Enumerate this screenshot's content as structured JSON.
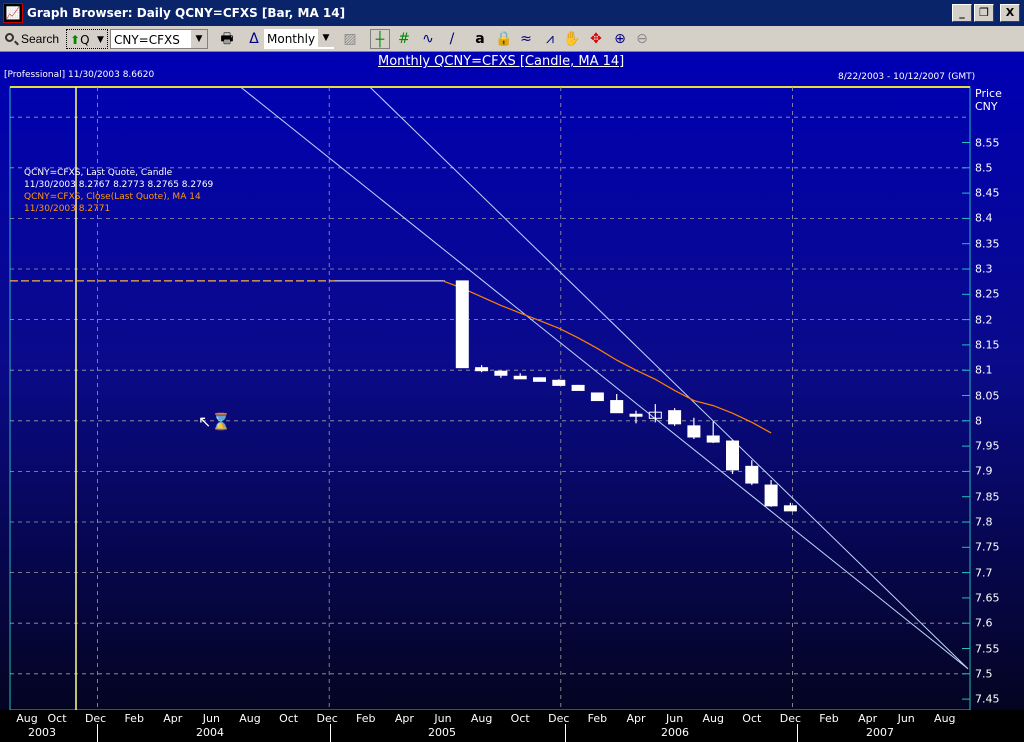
{
  "window": {
    "title": "Graph Browser: Daily QCNY=CFXS [Bar, MA 14]",
    "app_icon": "chart-icon",
    "minimize": "_",
    "maximize": "❐",
    "close": "X"
  },
  "toolbar": {
    "search_label": "Search",
    "quote_type": "Q",
    "symbol": "CNY=CFXS",
    "period": "Monthly",
    "icons": [
      "print-icon",
      "delta-icon",
      "folder-icon",
      "crosshair-icon",
      "grid-icon",
      "line-study-icon",
      "draw-line-icon",
      "text-icon",
      "lock-icon",
      "percent-scale-icon",
      "compare-icon",
      "pan-hand-icon",
      "move-icon",
      "zoom-in-icon",
      "zoom-out-icon"
    ]
  },
  "chart_data": {
    "type": "candlestick",
    "title": "Monthly QCNY=CFXS [Candle, MA 14]",
    "header_left": "[Professional] 11/30/2003 8.6620",
    "date_range": "8/22/2003 - 10/12/2007 (GMT)",
    "ylabel": "Price CNY",
    "ylabel_line1": "Price",
    "ylabel_line2": "CNY",
    "ylim": [
      7.43,
      8.66
    ],
    "yticks": [
      "8.55",
      "8.5",
      "8.45",
      "8.4",
      "8.35",
      "8.3",
      "8.25",
      "8.2",
      "8.15",
      "8.1",
      "8.05",
      "8",
      "7.95",
      "7.9",
      "7.85",
      "7.8",
      "7.75",
      "7.7",
      "7.65",
      "7.6",
      "7.55",
      "7.5",
      "7.45"
    ],
    "legend": {
      "series1_name": "QCNY=CFXS, Last Quote, Candle",
      "series1_values": "11/30/2003 8.2767 8.2773 8.2765 8.2769",
      "series2_name": "QCNY=CFXS, Close(Last Quote), MA 14",
      "series2_values": "11/30/2003 8.2771"
    },
    "month_labels": [
      "Aug",
      "Oct",
      "Dec",
      "Feb",
      "Apr",
      "Jun",
      "Aug",
      "Oct",
      "Dec",
      "Feb",
      "Apr",
      "Jun",
      "Aug",
      "Oct",
      "Dec",
      "Feb",
      "Apr",
      "Jun",
      "Aug",
      "Oct",
      "Dec",
      "Feb",
      "Apr",
      "Jun",
      "Aug"
    ],
    "year_labels": [
      "2003",
      "2004",
      "2005",
      "2006",
      "2007"
    ],
    "flat_price": 8.2765,
    "flat_start_month": 0,
    "flat_end_month": 22,
    "candles": [
      {
        "m": "Jul 2005",
        "o": 8.2765,
        "h": 8.2765,
        "l": 8.105,
        "c": 8.105
      },
      {
        "m": "Aug 2005",
        "o": 8.105,
        "h": 8.11,
        "l": 8.096,
        "c": 8.099
      },
      {
        "m": "Sep 2005",
        "o": 8.098,
        "h": 8.099,
        "l": 8.085,
        "c": 8.09
      },
      {
        "m": "Oct 2005",
        "o": 8.088,
        "h": 8.094,
        "l": 8.083,
        "c": 8.083
      },
      {
        "m": "Nov 2005",
        "o": 8.085,
        "h": 8.086,
        "l": 8.078,
        "c": 8.078
      },
      {
        "m": "Dec 2005",
        "o": 8.08,
        "h": 8.082,
        "l": 8.07,
        "c": 8.07
      },
      {
        "m": "Jan 2006",
        "o": 8.07,
        "h": 8.071,
        "l": 8.06,
        "c": 8.06
      },
      {
        "m": "Feb 2006",
        "o": 8.055,
        "h": 8.056,
        "l": 8.04,
        "c": 8.04
      },
      {
        "m": "Mar 2006",
        "o": 8.04,
        "h": 8.053,
        "l": 8.016,
        "c": 8.016
      },
      {
        "m": "Apr 2006",
        "o": 8.013,
        "h": 8.02,
        "l": 7.995,
        "c": 8.013
      },
      {
        "m": "May 2006",
        "o": 8.005,
        "h": 8.033,
        "l": 7.997,
        "c": 8.017
      },
      {
        "m": "Jun 2006",
        "o": 8.02,
        "h": 8.025,
        "l": 7.99,
        "c": 7.994
      },
      {
        "m": "Jul 2006",
        "o": 7.99,
        "h": 8.006,
        "l": 7.964,
        "c": 7.968
      },
      {
        "m": "Aug 2006",
        "o": 7.97,
        "h": 7.999,
        "l": 7.956,
        "c": 7.958
      },
      {
        "m": "Sep 2006",
        "o": 7.96,
        "h": 7.962,
        "l": 7.895,
        "c": 7.903
      },
      {
        "m": "Oct 2006",
        "o": 7.91,
        "h": 7.922,
        "l": 7.873,
        "c": 7.877
      },
      {
        "m": "Nov 2006",
        "o": 7.873,
        "h": 7.883,
        "l": 7.83,
        "c": 7.832
      },
      {
        "m": "Dec 2006",
        "o": 7.832,
        "h": 7.838,
        "l": 7.822,
        "c": 7.822
      }
    ],
    "ma14": [
      8.2765,
      8.262,
      8.245,
      8.228,
      8.213,
      8.198,
      8.183,
      8.164,
      8.143,
      8.12,
      8.1,
      8.082,
      8.06,
      8.04,
      8.03,
      8.015,
      7.997,
      7.976
    ],
    "ma_start_month": 22,
    "candle_start_month": 23,
    "trendlines": [
      {
        "from": [
          11.5,
          8.66
        ],
        "to": [
          49.2,
          7.51
        ]
      },
      {
        "from": [
          18.2,
          8.66
        ],
        "to": [
          49.2,
          7.51
        ]
      }
    ],
    "crosshair_month": 3,
    "colors": {
      "candle": "#ffffff",
      "ma": "#ff8000",
      "trend": "#c0d8ff",
      "grid": "#a0a0a0",
      "crosshair": "#ffff80",
      "legend_ma": "#ff9900"
    }
  }
}
